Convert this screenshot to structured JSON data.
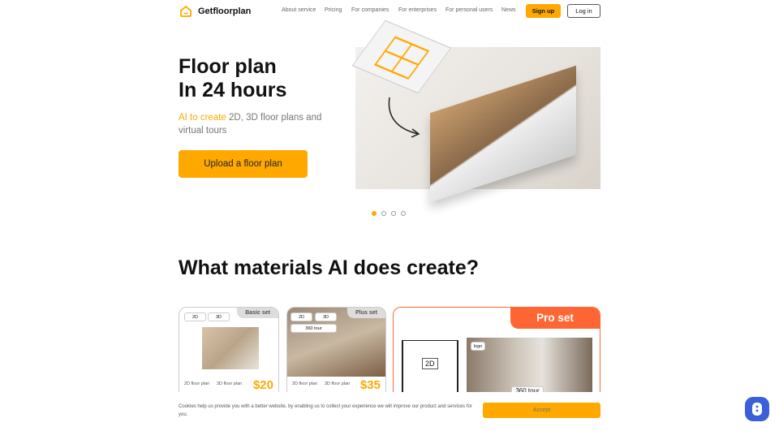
{
  "header": {
    "brand": "Getfloorplan",
    "nav": [
      "About service",
      "Pricing",
      "For companies",
      "For enterprises",
      "For personal users",
      "News"
    ],
    "signup": "Sign up",
    "login": "Log in"
  },
  "hero": {
    "title_line1": "Floor plan",
    "title_line2": "In 24 hours",
    "subtitle_accent": "AI to create",
    "subtitle_rest": " 2D, 3D floor plans and virtual tours",
    "cta": "Upload a floor plan",
    "slides": 4,
    "active_slide": 1
  },
  "materials": {
    "heading": "What materials AI does create?",
    "cards": [
      {
        "set": "Basic set",
        "tags": [
          "2D",
          "3D"
        ],
        "features": [
          "2D floor plan",
          "3D floor plan"
        ],
        "price": "$20"
      },
      {
        "set": "Plus set",
        "tags": [
          "2D",
          "3D",
          "360 tour"
        ],
        "features": [
          "2D floor plan",
          "3D floor plan"
        ],
        "price": "$35"
      },
      {
        "set": "Pro set",
        "labels": [
          "2D",
          "logo",
          "360 tour"
        ]
      }
    ]
  },
  "cookie": {
    "text": "Cookies help us provide you with a better website, by enabling us to collect your experience we will improve our product and services for you.",
    "accept": "Accept"
  },
  "colors": {
    "accent": "#ffa800",
    "pro": "#ff6633",
    "chat": "#3a5fd8"
  }
}
